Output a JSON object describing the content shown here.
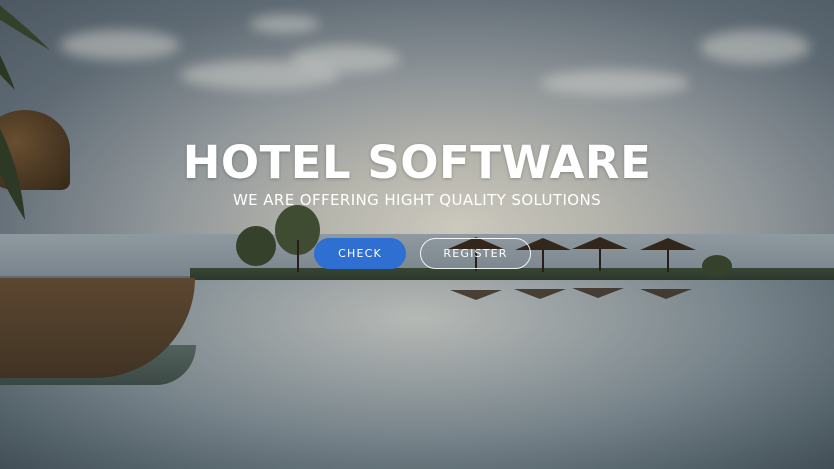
{
  "hero": {
    "title": "HOTEL SOFTWARE",
    "subtitle": "WE ARE OFFERING HIGHT QUALITY SOLUTIONS",
    "buttons": {
      "check_label": "CHECK",
      "register_label": "REGISTER"
    }
  },
  "colors": {
    "primary_button": "#2f6fd1",
    "text": "#ffffff"
  }
}
